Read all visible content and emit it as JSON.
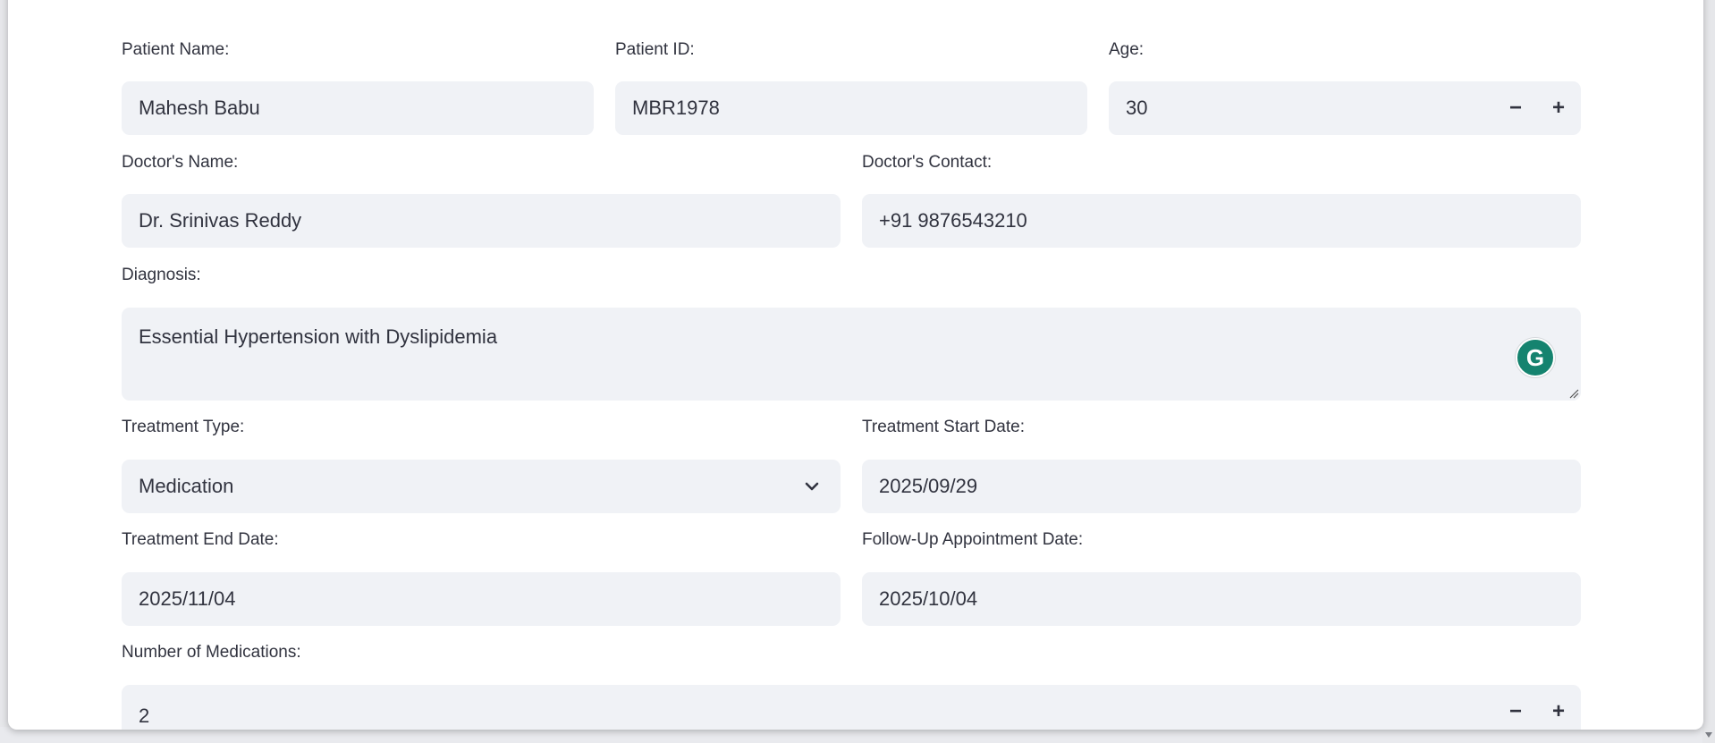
{
  "form": {
    "patient_name": {
      "label": "Patient Name:",
      "value": "Mahesh Babu"
    },
    "patient_id": {
      "label": "Patient ID:",
      "value": "MBR1978"
    },
    "age": {
      "label": "Age:",
      "value": "30",
      "decrement": "−",
      "increment": "+"
    },
    "doctor_name": {
      "label": "Doctor's Name:",
      "value": "Dr. Srinivas Reddy"
    },
    "doctor_contact": {
      "label": "Doctor's Contact:",
      "value": "+91 9876543210"
    },
    "diagnosis": {
      "label": "Diagnosis:",
      "value": "Essential Hypertension with Dyslipidemia"
    },
    "treatment_type": {
      "label": "Treatment Type:",
      "value": "Medication"
    },
    "treatment_start": {
      "label": "Treatment Start Date:",
      "value": "2025/09/29"
    },
    "treatment_end": {
      "label": "Treatment End Date:",
      "value": "2025/11/04"
    },
    "follow_up": {
      "label": "Follow-Up Appointment Date:",
      "value": "2025/10/04"
    },
    "num_medications": {
      "label": "Number of Medications:",
      "value": "2",
      "decrement": "−",
      "increment": "+"
    }
  },
  "icons": {
    "grammarly": "grammarly-icon",
    "dropdown": "chevron-down-icon",
    "resize": "resize-handle-icon",
    "grammarly_letter": "G"
  },
  "colors": {
    "input_bg": "#f0f2f6",
    "text": "#31333f",
    "grammarly": "#15836f"
  }
}
